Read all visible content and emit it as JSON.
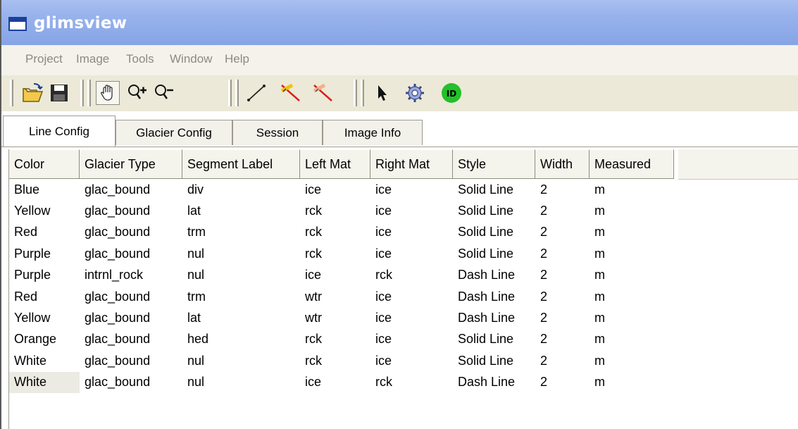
{
  "window": {
    "title": "glimsview"
  },
  "menu": [
    {
      "label": "Project"
    },
    {
      "label": "Image"
    },
    {
      "label": "Tools"
    },
    {
      "label": "Window"
    },
    {
      "label": "Help"
    }
  ],
  "toolbar_icons": [
    "open-folder-icon",
    "save-icon",
    "pan-hand-icon",
    "zoom-in-icon",
    "zoom-out-icon",
    "draw-line-icon",
    "edit-line-icon",
    "delete-line-icon",
    "select-arrow-icon",
    "settings-gear-icon",
    "id-icon"
  ],
  "id_badge_text": "ID",
  "tabs": [
    {
      "label": "Line Config",
      "active": true
    },
    {
      "label": "Glacier Config"
    },
    {
      "label": "Session"
    },
    {
      "label": "Image Info"
    }
  ],
  "table": {
    "columns": [
      "Color",
      "Glacier Type",
      "Segment Label",
      "Left Mat",
      "Right Mat",
      "Style",
      "Width",
      "Measured"
    ],
    "rows": [
      [
        "Blue",
        "glac_bound",
        "div",
        "ice",
        "ice",
        "Solid Line",
        "2",
        "m"
      ],
      [
        "Yellow",
        "glac_bound",
        "lat",
        "rck",
        "ice",
        "Solid Line",
        "2",
        "m"
      ],
      [
        "Red",
        "glac_bound",
        "trm",
        "rck",
        "ice",
        "Solid Line",
        "2",
        "m"
      ],
      [
        "Purple",
        "glac_bound",
        "nul",
        "rck",
        "ice",
        "Solid Line",
        "2",
        "m"
      ],
      [
        "Purple",
        "intrnl_rock",
        "nul",
        "ice",
        "rck",
        "Dash Line",
        "2",
        "m"
      ],
      [
        "Red",
        "glac_bound",
        "trm",
        "wtr",
        "ice",
        "Dash Line",
        "2",
        "m"
      ],
      [
        "Yellow",
        "glac_bound",
        "lat",
        "wtr",
        "ice",
        "Dash Line",
        "2",
        "m"
      ],
      [
        "Orange",
        "glac_bound",
        "hed",
        "rck",
        "ice",
        "Solid Line",
        "2",
        "m"
      ],
      [
        "White",
        "glac_bound",
        "nul",
        "rck",
        "ice",
        "Solid Line",
        "2",
        "m"
      ],
      [
        "White",
        "glac_bound",
        "nul",
        "ice",
        "rck",
        "Dash Line",
        "2",
        "m"
      ]
    ],
    "selected_row": 9
  },
  "colors": {
    "titlebar": "#98b2ec",
    "title_text": "#ffffff",
    "id_badge": "#22c02a"
  }
}
